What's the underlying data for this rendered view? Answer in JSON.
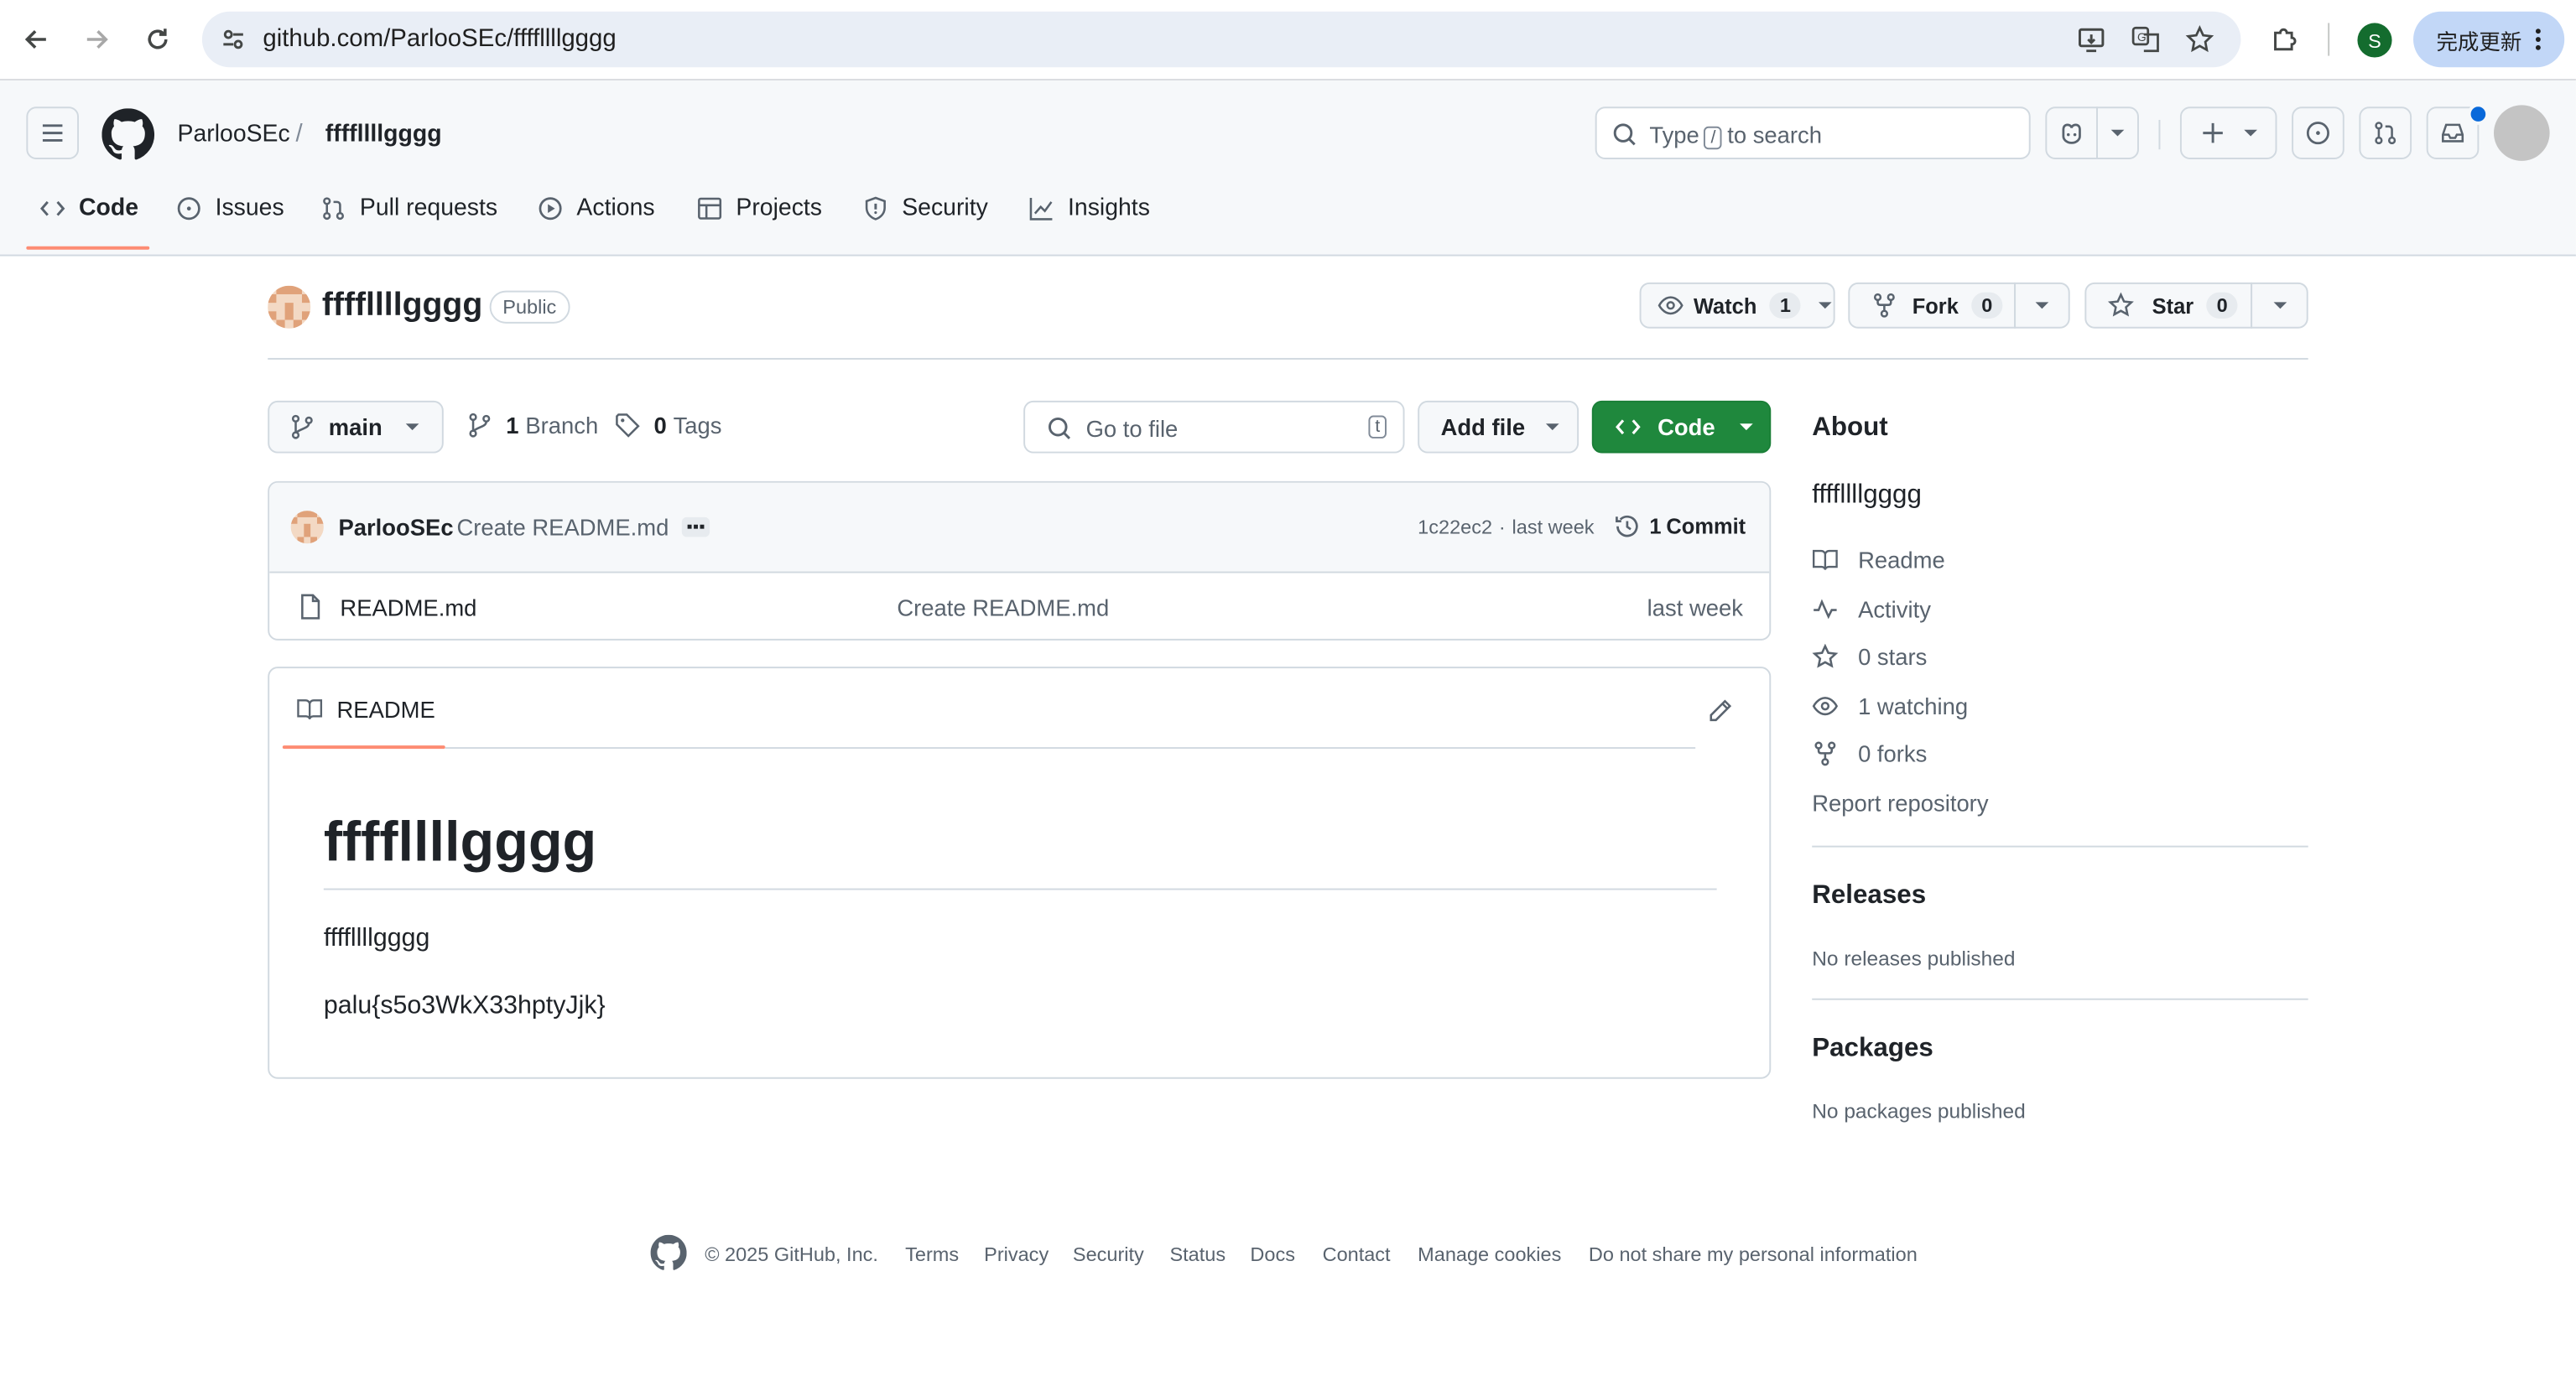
{
  "browser": {
    "url": "github.com/ParlooSEc/ffffllllgggg",
    "update_label": "完成更新",
    "profile_initial": "S"
  },
  "header": {
    "owner": "ParlooSEc",
    "separator": "/",
    "repo": "ffffllllgggg",
    "search_prefix": "Type",
    "search_key": "/",
    "search_suffix": "to search"
  },
  "tabs": [
    {
      "label": "Code"
    },
    {
      "label": "Issues"
    },
    {
      "label": "Pull requests"
    },
    {
      "label": "Actions"
    },
    {
      "label": "Projects"
    },
    {
      "label": "Security"
    },
    {
      "label": "Insights"
    }
  ],
  "repo": {
    "name": "ffffllllgggg",
    "visibility": "Public",
    "watch_label": "Watch",
    "watch_count": "1",
    "fork_label": "Fork",
    "fork_count": "0",
    "star_label": "Star",
    "star_count": "0"
  },
  "toolbar": {
    "branch": "main",
    "branches_count": "1",
    "branches_label": "Branch",
    "tags_count": "0",
    "tags_label": "Tags",
    "goto_placeholder": "Go to file",
    "goto_key": "t",
    "add_file": "Add file",
    "code": "Code"
  },
  "commit": {
    "author": "ParlooSEc",
    "message": "Create README.md",
    "hash": "1c22ec2",
    "dot": "·",
    "time": "last week",
    "commits_count": "1",
    "commits_label": "Commit"
  },
  "files": [
    {
      "name": "README.md",
      "message": "Create README.md",
      "time": "last week"
    }
  ],
  "readme": {
    "tab_label": "README",
    "heading": "ffffllllgggg",
    "paragraphs": [
      "ffffllllgggg",
      "palu{s5o3WkX33hptyJjk}"
    ]
  },
  "about": {
    "title": "About",
    "description": "ffffllllgggg",
    "links": [
      {
        "label": "Readme",
        "icon": "book-icon"
      },
      {
        "label": "Activity",
        "icon": "pulse-icon"
      },
      {
        "label": "0 stars",
        "icon": "star-icon"
      },
      {
        "label": "1 watching",
        "icon": "eye-icon"
      },
      {
        "label": "0 forks",
        "icon": "fork-icon"
      }
    ],
    "report": "Report repository"
  },
  "releases": {
    "title": "Releases",
    "text": "No releases published"
  },
  "packages": {
    "title": "Packages",
    "text": "No packages published"
  },
  "footer": {
    "copyright": "© 2025 GitHub, Inc.",
    "links": [
      "Terms",
      "Privacy",
      "Security",
      "Status",
      "Docs",
      "Contact",
      "Manage cookies",
      "Do not share my personal information"
    ]
  },
  "colors": {
    "accent_green": "#1f883d",
    "tab_underline": "#fd8c73",
    "link_blue": "#0969da"
  }
}
